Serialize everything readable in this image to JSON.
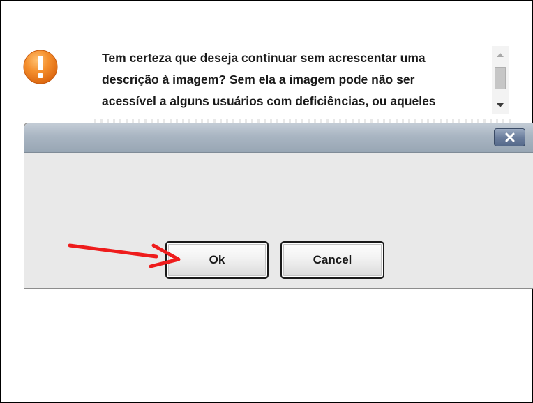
{
  "dialog": {
    "close_icon": "close-icon",
    "warning_icon": "exclamation-warning-icon",
    "message": "Tem certeza que deseja continuar sem acrescentar uma\ndescrição à imagem? Sem ela a imagem pode não ser\nacessível a alguns usuários com deficiências, ou aqueles",
    "scroll_up_icon": "scroll-up-arrow-icon",
    "scroll_down_icon": "scroll-down-arrow-icon",
    "ok_label": "Ok",
    "cancel_label": "Cancel"
  },
  "annotation": {
    "arrow_icon": "red-arrow-icon",
    "arrow_color": "#ee1c1c"
  },
  "colors": {
    "warning_orange": "#f07f1e",
    "titlebar": "#a9b5c2",
    "dialog_background": "#e9e9e9"
  }
}
